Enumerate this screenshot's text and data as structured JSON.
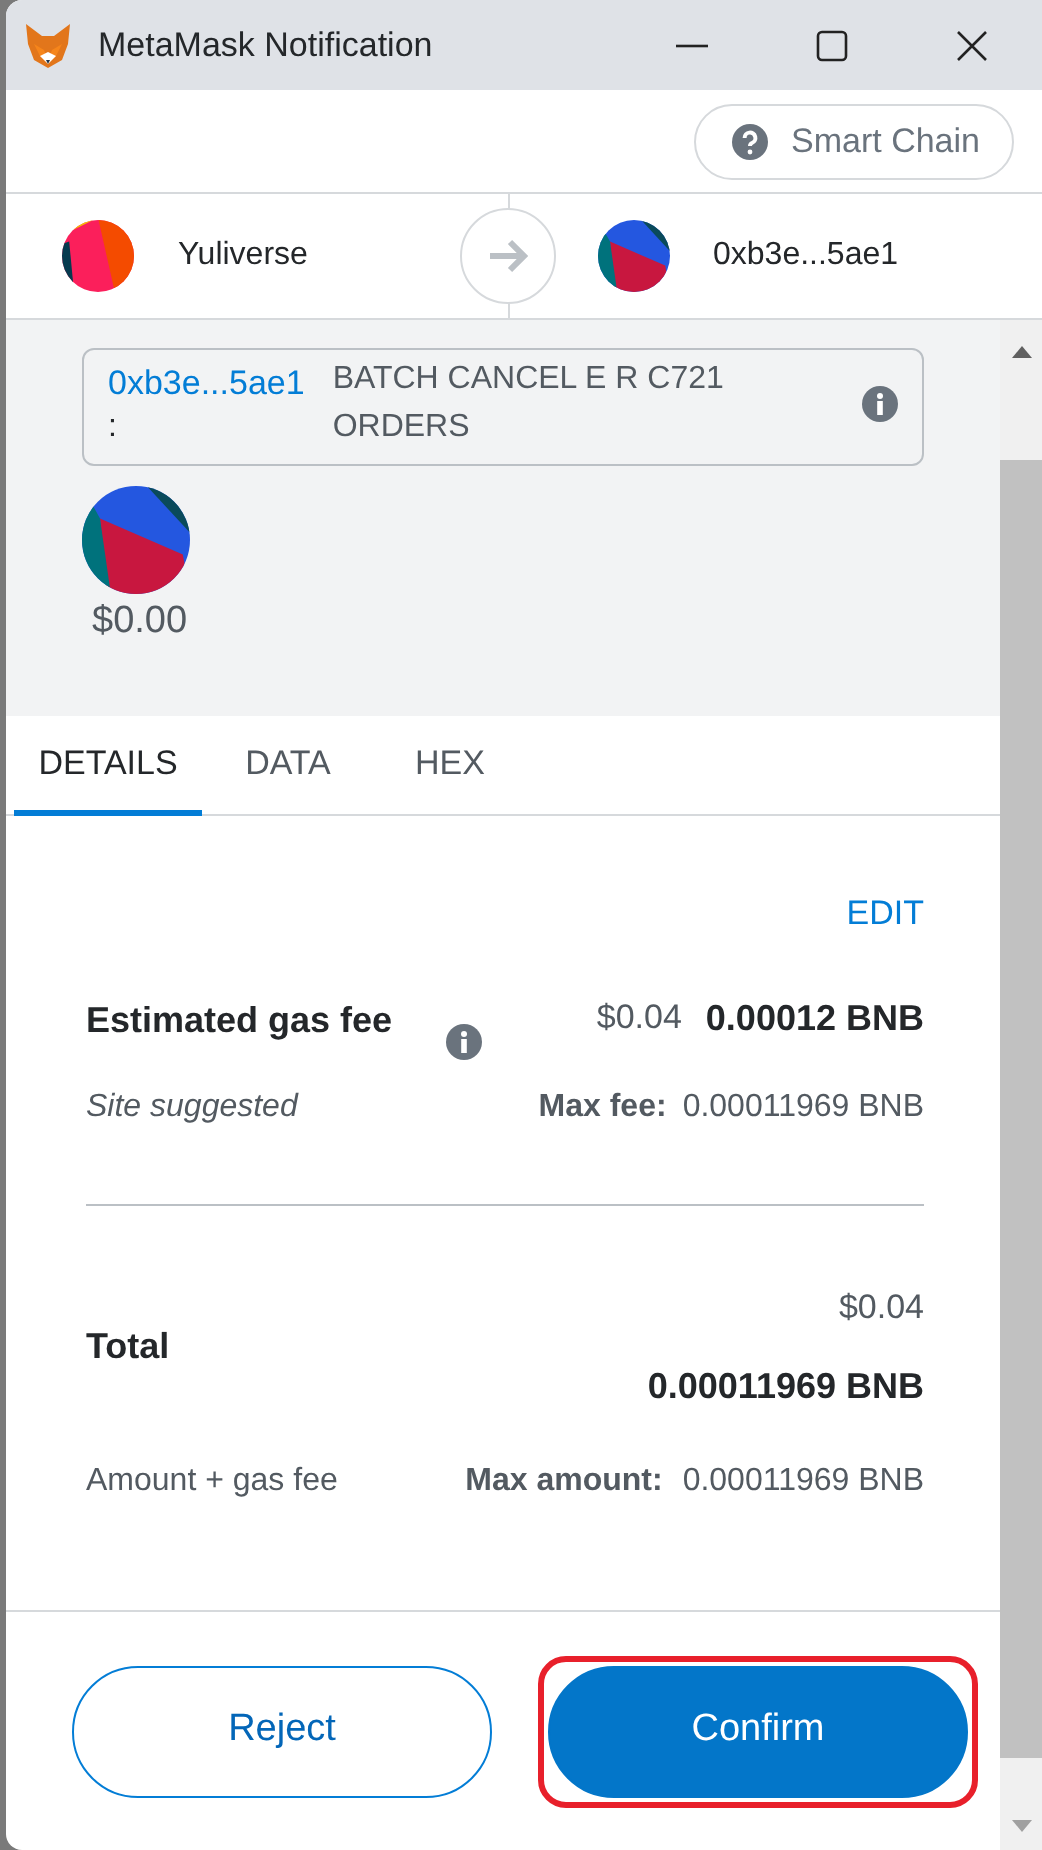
{
  "window": {
    "title": "MetaMask Notification"
  },
  "network": {
    "label": "Smart Chain"
  },
  "from_account": {
    "name": "Yuliverse"
  },
  "to_account": {
    "name": "0xb3e...5ae1"
  },
  "method": {
    "address": "0xb3e...5ae1",
    "separator": ":",
    "label": "BATCH CANCEL E R C721 ORDERS"
  },
  "value": "$0.00",
  "tabs": [
    {
      "label": "DETAILS",
      "selected": true
    },
    {
      "label": "DATA",
      "selected": false
    },
    {
      "label": "HEX",
      "selected": false
    }
  ],
  "edit_link": "EDIT",
  "gas_fee": {
    "label": "Estimated gas fee",
    "fiat": "$0.04",
    "amount": "0.00012 BNB",
    "note": "Site suggested",
    "max_label": "Max fee:",
    "max_value": "0.00011969 BNB"
  },
  "total": {
    "label": "Total",
    "fiat": "$0.04",
    "amount": "0.00011969 BNB",
    "note": "Amount + gas fee",
    "max_label": "Max amount:",
    "max_value": "0.00011969 BNB"
  },
  "buttons": [
    {
      "label": "Reject",
      "kind": "secondary",
      "highlighted": false
    },
    {
      "label": "Confirm",
      "kind": "primary",
      "highlighted": true
    }
  ]
}
